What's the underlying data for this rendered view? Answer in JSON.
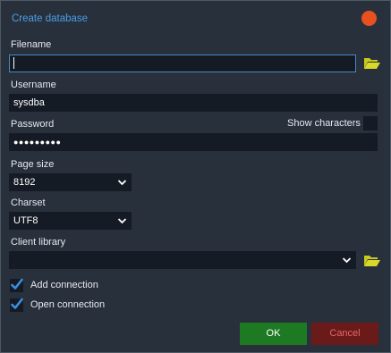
{
  "dialog": {
    "title": "Create database"
  },
  "filename": {
    "label": "Filename",
    "value": ""
  },
  "username": {
    "label": "Username",
    "value": "sysdba"
  },
  "password": {
    "label": "Password",
    "masked_value": "●●●●●●●●●",
    "show_characters_label": "Show characters",
    "show_characters_checked": false
  },
  "page_size": {
    "label": "Page size",
    "selected": "8192"
  },
  "charset": {
    "label": "Charset",
    "selected": "UTF8"
  },
  "client_library": {
    "label": "Client library",
    "selected": ""
  },
  "options": {
    "add_connection_label": "Add connection",
    "add_connection_checked": true,
    "open_connection_label": "Open connection",
    "open_connection_checked": true
  },
  "buttons": {
    "ok_label": "OK",
    "cancel_label": "Cancel"
  },
  "icons": {
    "close": "close-icon",
    "folder": "folder-open-icon",
    "chevron": "chevron-down-icon",
    "check": "checkmark-icon"
  },
  "colors": {
    "accent": "#4a9ee6",
    "close": "#e8501f",
    "ok": "#1e7a22",
    "cancel": "#6b1a1a",
    "folder": "#c8c81e"
  }
}
